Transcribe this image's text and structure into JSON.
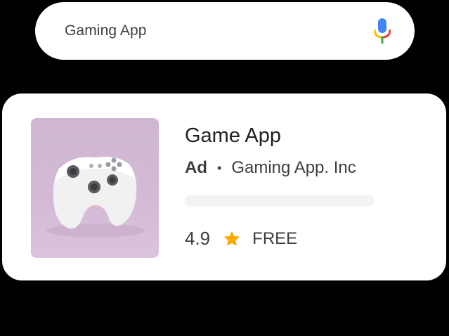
{
  "search": {
    "query": "Gaming App",
    "mic_icon": "mic-icon"
  },
  "result": {
    "app_name": "Game App",
    "ad_label": "Ad",
    "separator": "•",
    "developer": "Gaming App. Inc",
    "rating": "4.9",
    "price": "FREE",
    "thumbnail_icon": "game-controller-image",
    "star_icon": "star-icon"
  },
  "colors": {
    "mic_blue": "#4285F4",
    "mic_red": "#EA4335",
    "mic_yellow": "#FBBC05",
    "mic_green": "#34A853",
    "star": "#F9AB00",
    "thumbnail_bg": "#D3B9D4"
  }
}
